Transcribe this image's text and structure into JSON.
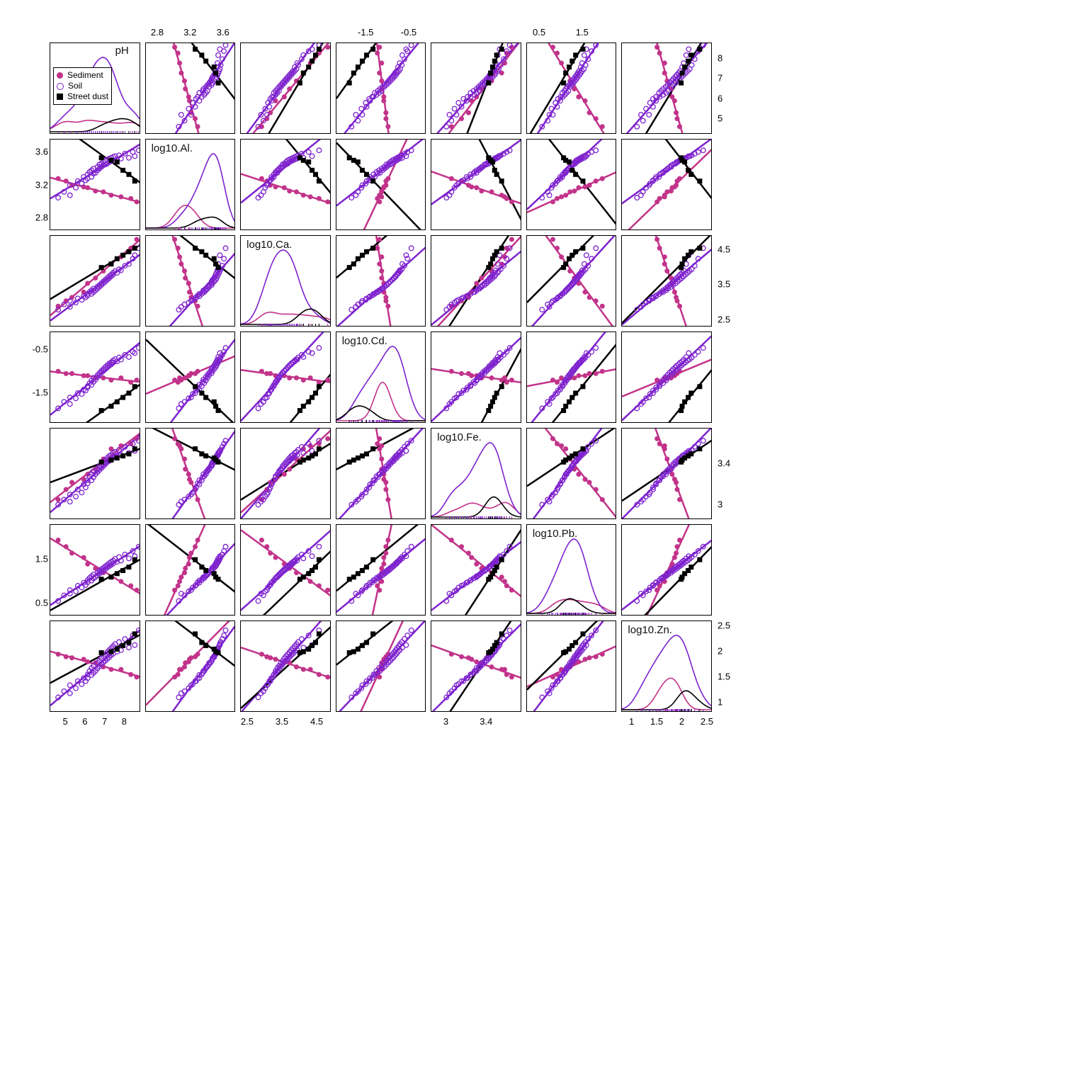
{
  "chart_data": {
    "type": "scatter",
    "description": "R pairs scatterplot matrix of pH and log10-transformed metal concentrations, grouped by sample type (Sediment, Soil, Street dust). Each off-diagonal panel is a scatterplot with per-group linear fits; diagonal panels show per-group density curves.",
    "variables": [
      "pH",
      "log10.Al.",
      "log10.Ca.",
      "log10.Cd.",
      "log10.Fe.",
      "log10.Pb.",
      "log10.Zn."
    ],
    "groups": [
      {
        "name": "Sediment",
        "marker": "filled-circle",
        "color": "#c2338a"
      },
      {
        "name": "Soil",
        "marker": "open-circle",
        "color": "#7e22ce"
      },
      {
        "name": "Street dust",
        "marker": "filled-square",
        "color": "#000000"
      }
    ],
    "ranges": {
      "pH": [
        4.2,
        8.8
      ],
      "log10.Al.": [
        2.65,
        3.75
      ],
      "log10.Ca.": [
        2.3,
        4.9
      ],
      "log10.Cd.": [
        -2.2,
        -0.1
      ],
      "log10.Fe.": [
        2.85,
        3.75
      ],
      "log10.Pb.": [
        0.2,
        2.3
      ],
      "log10.Zn.": [
        0.8,
        2.6
      ]
    },
    "axis_ticks": {
      "pH": [
        5,
        6,
        7,
        8
      ],
      "log10.Al.": [
        2.8,
        3.2,
        3.6
      ],
      "log10.Ca.": [
        2.5,
        3.5,
        4.5
      ],
      "log10.Cd.": [
        -1.5,
        -0.5
      ],
      "log10.Fe.": [
        3.0,
        3.4
      ],
      "log10.Pb.": [
        0.5,
        1.5
      ],
      "log10.Zn.": [
        1.0,
        1.5,
        2.0,
        2.5
      ]
    },
    "samples": {
      "Sediment": {
        "pH": [
          4.6,
          5.0,
          5.3,
          5.9,
          6.1,
          6.5,
          6.9,
          7.3,
          7.8,
          8.3,
          8.6
        ],
        "log10.Al.": [
          3.28,
          3.25,
          3.2,
          3.18,
          3.17,
          3.13,
          3.12,
          3.08,
          3.06,
          3.04,
          3.0
        ],
        "log10.Ca.": [
          2.9,
          3.05,
          3.15,
          3.3,
          3.55,
          3.7,
          3.9,
          4.1,
          4.3,
          4.55,
          4.8
        ],
        "log10.Cd.": [
          -1.0,
          -1.05,
          -1.05,
          -1.1,
          -1.1,
          -1.15,
          -1.15,
          -1.2,
          -1.15,
          -1.25,
          -1.2
        ],
        "log10.Fe.": [
          3.05,
          3.15,
          3.22,
          3.25,
          3.3,
          3.35,
          3.45,
          3.55,
          3.58,
          3.6,
          3.65
        ],
        "log10.Pb.": [
          1.95,
          1.8,
          1.65,
          1.55,
          1.4,
          1.3,
          1.2,
          1.1,
          1.0,
          0.9,
          0.8
        ],
        "log10.Zn.": [
          1.95,
          1.9,
          1.88,
          1.85,
          1.8,
          1.78,
          1.7,
          1.65,
          1.65,
          1.55,
          1.5
        ]
      },
      "Soil": {
        "pH": [
          4.6,
          4.9,
          5.2,
          5.2,
          5.5,
          5.6,
          5.8,
          5.9,
          6.0,
          6.1,
          6.1,
          6.2,
          6.3,
          6.3,
          6.4,
          6.4,
          6.5,
          6.6,
          6.6,
          6.7,
          6.7,
          6.8,
          6.8,
          6.9,
          6.9,
          7.0,
          7.0,
          7.1,
          7.1,
          7.2,
          7.2,
          7.3,
          7.3,
          7.4,
          7.4,
          7.5,
          7.6,
          7.7,
          7.8,
          8.0,
          8.2,
          8.4,
          8.5,
          8.7
        ],
        "log10.Al.": [
          3.05,
          3.12,
          3.08,
          3.2,
          3.17,
          3.25,
          3.22,
          3.3,
          3.26,
          3.33,
          3.28,
          3.36,
          3.3,
          3.38,
          3.34,
          3.4,
          3.35,
          3.42,
          3.38,
          3.45,
          3.4,
          3.46,
          3.42,
          3.48,
          3.44,
          3.5,
          3.45,
          3.51,
          3.46,
          3.52,
          3.48,
          3.53,
          3.49,
          3.54,
          3.5,
          3.55,
          3.51,
          3.56,
          3.52,
          3.58,
          3.53,
          3.6,
          3.55,
          3.62
        ],
        "log10.Ca.": [
          2.8,
          2.95,
          2.88,
          3.05,
          3.0,
          3.12,
          3.08,
          3.18,
          3.15,
          3.25,
          3.2,
          3.3,
          3.25,
          3.35,
          3.3,
          3.4,
          3.35,
          3.45,
          3.4,
          3.5,
          3.45,
          3.55,
          3.5,
          3.6,
          3.55,
          3.65,
          3.6,
          3.7,
          3.65,
          3.75,
          3.7,
          3.8,
          3.75,
          3.85,
          3.8,
          3.9,
          3.85,
          3.95,
          3.92,
          4.05,
          4.1,
          4.25,
          4.35,
          4.55
        ],
        "log10.Cd.": [
          -1.85,
          -1.7,
          -1.75,
          -1.6,
          -1.62,
          -1.5,
          -1.52,
          -1.42,
          -1.44,
          -1.34,
          -1.37,
          -1.27,
          -1.31,
          -1.21,
          -1.24,
          -1.15,
          -1.19,
          -1.09,
          -1.13,
          -1.04,
          -1.08,
          -0.99,
          -1.03,
          -0.95,
          -0.99,
          -0.9,
          -0.95,
          -0.86,
          -0.91,
          -0.82,
          -0.87,
          -0.79,
          -0.84,
          -0.75,
          -0.8,
          -0.72,
          -0.77,
          -0.68,
          -0.73,
          -0.62,
          -0.67,
          -0.55,
          -0.58,
          -0.46
        ],
        "log10.Fe.": [
          3.0,
          3.05,
          3.03,
          3.1,
          3.08,
          3.15,
          3.12,
          3.2,
          3.17,
          3.24,
          3.21,
          3.28,
          3.24,
          3.3,
          3.27,
          3.33,
          3.3,
          3.35,
          3.32,
          3.38,
          3.34,
          3.4,
          3.36,
          3.42,
          3.38,
          3.44,
          3.4,
          3.46,
          3.42,
          3.48,
          3.43,
          3.49,
          3.45,
          3.51,
          3.46,
          3.52,
          3.48,
          3.54,
          3.49,
          3.57,
          3.51,
          3.6,
          3.53,
          3.63
        ],
        "log10.Pb.": [
          0.55,
          0.68,
          0.72,
          0.8,
          0.77,
          0.9,
          0.86,
          0.97,
          0.92,
          1.03,
          0.98,
          1.08,
          1.02,
          1.12,
          1.07,
          1.16,
          1.1,
          1.2,
          1.14,
          1.24,
          1.18,
          1.28,
          1.22,
          1.31,
          1.25,
          1.35,
          1.28,
          1.38,
          1.32,
          1.42,
          1.35,
          1.45,
          1.38,
          1.48,
          1.41,
          1.52,
          1.45,
          1.56,
          1.48,
          1.62,
          1.53,
          1.7,
          1.58,
          1.8
        ],
        "log10.Zn.": [
          1.1,
          1.22,
          1.18,
          1.34,
          1.28,
          1.42,
          1.36,
          1.48,
          1.42,
          1.55,
          1.48,
          1.62,
          1.54,
          1.68,
          1.58,
          1.72,
          1.62,
          1.78,
          1.67,
          1.82,
          1.71,
          1.87,
          1.75,
          1.91,
          1.79,
          1.95,
          1.82,
          1.99,
          1.86,
          2.03,
          1.89,
          2.07,
          1.93,
          2.11,
          1.96,
          2.15,
          2.0,
          2.19,
          2.03,
          2.25,
          2.08,
          2.32,
          2.13,
          2.42
        ]
      },
      "Street dust": {
        "pH": [
          6.8,
          7.3,
          7.6,
          7.9,
          8.2,
          8.5
        ],
        "log10.Al.": [
          3.53,
          3.5,
          3.48,
          3.38,
          3.33,
          3.25
        ],
        "log10.Ca.": [
          4.0,
          4.1,
          4.25,
          4.35,
          4.45,
          4.55
        ],
        "log10.Cd.": [
          -1.9,
          -1.8,
          -1.7,
          -1.6,
          -1.5,
          -1.35
        ],
        "log10.Fe.": [
          3.42,
          3.44,
          3.46,
          3.48,
          3.5,
          3.55
        ],
        "log10.Pb.": [
          1.05,
          1.1,
          1.18,
          1.25,
          1.33,
          1.5
        ],
        "log10.Zn.": [
          1.98,
          2.0,
          2.05,
          2.12,
          2.18,
          2.35
        ]
      }
    }
  },
  "legend": {
    "items": [
      "Sediment",
      "Soil",
      "Street dust"
    ]
  }
}
